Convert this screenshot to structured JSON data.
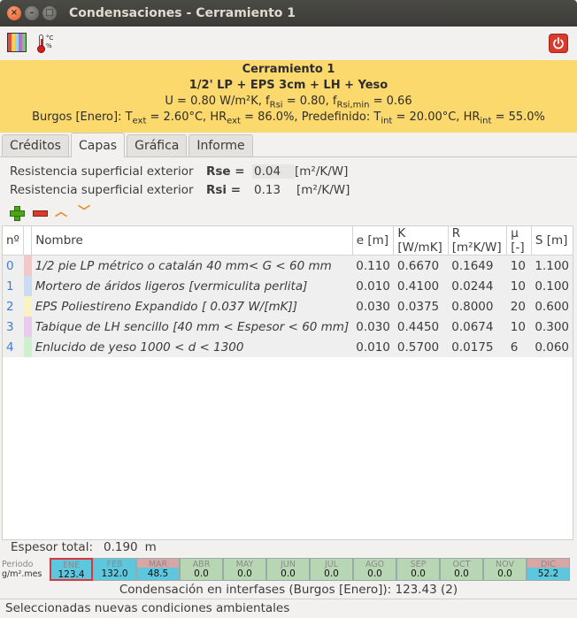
{
  "window": {
    "title": "Condensaciones - Cerramiento 1"
  },
  "header": {
    "name": "Cerramiento 1",
    "composition": "1/2' LP + EPS 3cm + LH + Yeso",
    "u_line": {
      "u": "U = 0.80 W/m²K, f",
      "frsi_sub": "Rsi",
      "frsi": " = 0.80, f",
      "frsimin_sub": "Rsi,min",
      "frsimin": " = 0.66"
    },
    "climate_line": {
      "a": "Burgos [Enero]: T",
      "a_sub": "ext",
      "b": " = 2.60°C, HR",
      "b_sub": "ext",
      "c": " = 86.0%, Predefinido: T",
      "c_sub": "int",
      "d": " = 20.00°C, HR",
      "d_sub": "int",
      "e": " = 55.0%"
    }
  },
  "tabs": [
    "Créditos",
    "Capas",
    "Gráfica",
    "Informe"
  ],
  "surface": {
    "rse": {
      "label": "Resistencia superficial exterior",
      "symbol": "Rse =",
      "value": "0.04",
      "unit": "[m²/K/W]"
    },
    "rsi": {
      "label": "Resistencia superficial exterior",
      "symbol": "Rsi =",
      "value": "0.13",
      "unit": "[m²/K/W]"
    }
  },
  "table": {
    "headers": [
      "nº",
      "",
      "Nombre",
      "e [m]",
      "K [W/mK]",
      "R [m²K/W]",
      "μ [-]",
      "S [m]"
    ],
    "rows": [
      {
        "n": "0",
        "color": "#f6c7c7",
        "name": "1/2 pie LP métrico o catalán 40 mm< G < 60 mm",
        "e": "0.110",
        "k": "0.6670",
        "r": "0.1649",
        "mu": "10",
        "s": "1.100"
      },
      {
        "n": "1",
        "color": "#c9dcf5",
        "name": "Mortero de áridos ligeros [vermiculita perlita]",
        "e": "0.010",
        "k": "0.4100",
        "r": "0.0244",
        "mu": "10",
        "s": "0.100"
      },
      {
        "n": "2",
        "color": "#fbf2c0",
        "name": "EPS Poliestireno Expandido [ 0.037 W/[mK]]",
        "e": "0.030",
        "k": "0.0375",
        "r": "0.8000",
        "mu": "20",
        "s": "0.600"
      },
      {
        "n": "3",
        "color": "#ecc9f1",
        "name": "Tabique de LH sencillo [40 mm < Espesor < 60 mm]",
        "e": "0.030",
        "k": "0.4450",
        "r": "0.0674",
        "mu": "10",
        "s": "0.300"
      },
      {
        "n": "4",
        "color": "#cdf0cd",
        "name": "Enlucido de yeso 1000 < d < 1300",
        "e": "0.010",
        "k": "0.5700",
        "r": "0.0175",
        "mu": "6",
        "s": "0.060"
      }
    ]
  },
  "total": {
    "label": "Espesor total:",
    "value": "0.190",
    "unit": "m"
  },
  "months": {
    "label_top": "Periodo",
    "label_bottom": "g/m².mes",
    "items": [
      {
        "name": "ENE",
        "value": "123.4",
        "bg": "#5fc7dd",
        "selected": true
      },
      {
        "name": "FEB",
        "value": "132.0",
        "bg": "#5fc7dd",
        "selected": false
      },
      {
        "name": "MAR",
        "value": "48.5",
        "bg": "#5fc7dd",
        "top": "#d9a6a6",
        "selected": false
      },
      {
        "name": "ABR",
        "value": "0.0",
        "bg": "#b9d6b4",
        "selected": false
      },
      {
        "name": "MAY",
        "value": "0.0",
        "bg": "#b9d6b4",
        "selected": false
      },
      {
        "name": "JUN",
        "value": "0.0",
        "bg": "#b9d6b4",
        "selected": false
      },
      {
        "name": "JUL",
        "value": "0.0",
        "bg": "#b9d6b4",
        "selected": false
      },
      {
        "name": "AGO",
        "value": "0.0",
        "bg": "#b9d6b4",
        "selected": false
      },
      {
        "name": "SEP",
        "value": "0.0",
        "bg": "#b9d6b4",
        "selected": false
      },
      {
        "name": "OCT",
        "value": "0.0",
        "bg": "#b9d6b4",
        "selected": false
      },
      {
        "name": "NOV",
        "value": "0.0",
        "bg": "#b9d6b4",
        "selected": false
      },
      {
        "name": "DIC",
        "value": "52.2",
        "bg": "#5fc7dd",
        "top": "#d9a6a6",
        "selected": false
      }
    ]
  },
  "condensation": "Condensación en interfases (Burgos [Enero]): 123.43 (2)",
  "status": "Seleccionadas nuevas condiciones ambientales",
  "colors": {
    "header_bg": "#fbd96c",
    "accent_red": "#d93a2c"
  }
}
